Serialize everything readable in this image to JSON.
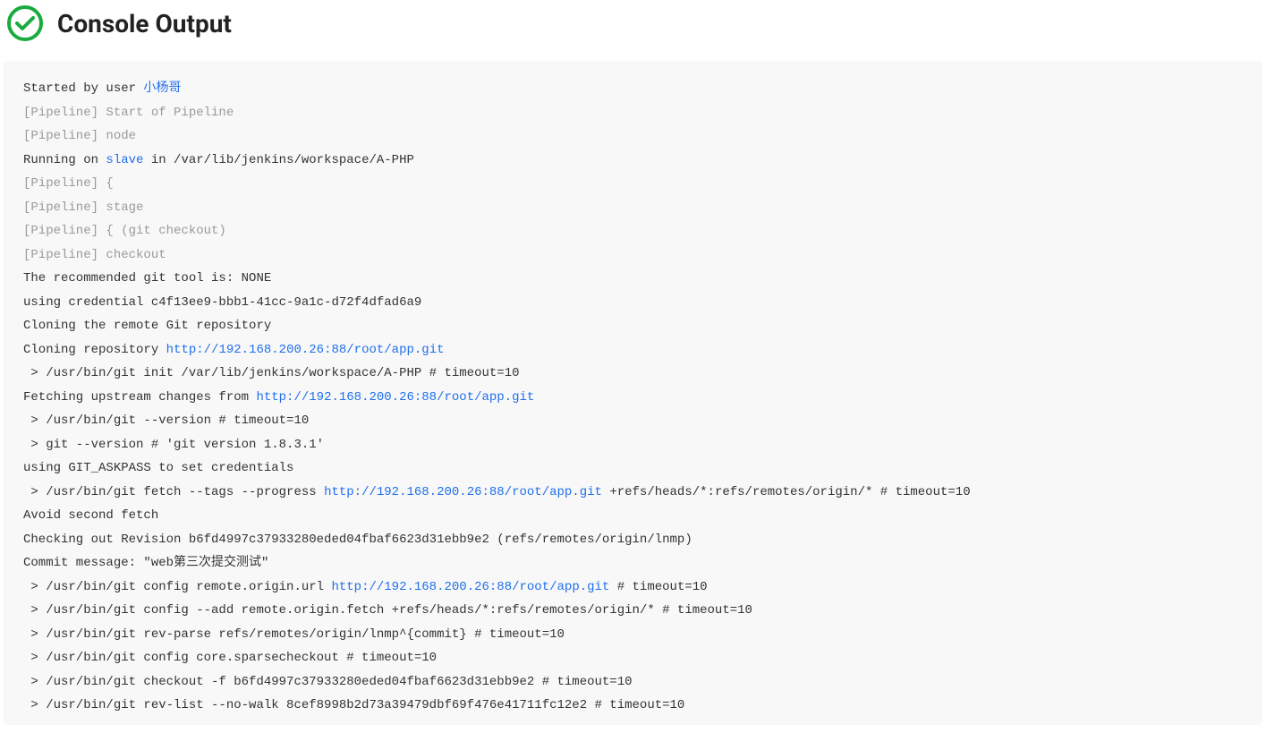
{
  "header": {
    "title": "Console Output",
    "icon": "success-check"
  },
  "links": {
    "user": "小杨哥",
    "node": "slave",
    "repo_url": "http://192.168.200.26:88/root/app.git"
  },
  "console": {
    "l01a": "Started by user ",
    "l02": "[Pipeline] Start of Pipeline",
    "l03": "[Pipeline] node",
    "l04a": "Running on ",
    "l04b": " in /var/lib/jenkins/workspace/A-PHP",
    "l05": "[Pipeline] {",
    "l06": "[Pipeline] stage",
    "l07": "[Pipeline] { (git checkout)",
    "l08": "[Pipeline] checkout",
    "l09": "The recommended git tool is: NONE",
    "l10": "using credential c4f13ee9-bbb1-41cc-9a1c-d72f4dfad6a9",
    "l11": "Cloning the remote Git repository",
    "l12a": "Cloning repository ",
    "l13": " > /usr/bin/git init /var/lib/jenkins/workspace/A-PHP # timeout=10",
    "l14a": "Fetching upstream changes from ",
    "l15": " > /usr/bin/git --version # timeout=10",
    "l16": " > git --version # 'git version 1.8.3.1'",
    "l17": "using GIT_ASKPASS to set credentials ",
    "l18a": " > /usr/bin/git fetch --tags --progress ",
    "l18b": " +refs/heads/*:refs/remotes/origin/* # timeout=10",
    "l19": "Avoid second fetch",
    "l20": "Checking out Revision b6fd4997c37933280eded04fbaf6623d31ebb9e2 (refs/remotes/origin/lnmp)",
    "l21": "Commit message: \"web第三次提交测试\"",
    "l22a": " > /usr/bin/git config remote.origin.url ",
    "l22b": " # timeout=10",
    "l23": " > /usr/bin/git config --add remote.origin.fetch +refs/heads/*:refs/remotes/origin/* # timeout=10",
    "l24": " > /usr/bin/git rev-parse refs/remotes/origin/lnmp^{commit} # timeout=10",
    "l25": " > /usr/bin/git config core.sparsecheckout # timeout=10",
    "l26": " > /usr/bin/git checkout -f b6fd4997c37933280eded04fbaf6623d31ebb9e2 # timeout=10",
    "l27": " > /usr/bin/git rev-list --no-walk 8cef8998b2d73a39479dbf69f476e41711fc12e2 # timeout=10"
  }
}
